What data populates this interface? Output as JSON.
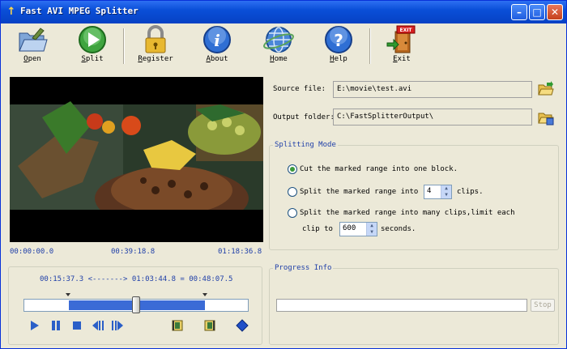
{
  "window": {
    "title": "Fast AVI MPEG Splitter"
  },
  "toolbar": {
    "open": "Open",
    "split": "Split",
    "register": "Register",
    "about": "About",
    "home": "Home",
    "help": "Help",
    "exit": "Exit",
    "exit_sign": "EXIT"
  },
  "player": {
    "time_start": "00:00:00.0",
    "time_current": "00:39:18.8",
    "time_end": "01:18:36.8",
    "range_start": "00:15:37.3",
    "range_arrow": "<------->",
    "range_end": "01:03:44.8",
    "range_equals": "=",
    "range_length": "00:48:07.5",
    "position_fraction": 0.5,
    "selection_start_fraction": 0.2,
    "selection_end_fraction": 0.81
  },
  "files": {
    "source_label": "Source file:",
    "source_value": "E:\\movie\\test.avi",
    "output_label": "Output folder:",
    "output_value": "C:\\FastSplitterOutput\\"
  },
  "splitting": {
    "legend": "Splitting Mode",
    "option1": "Cut the marked range into one block.",
    "option2_pre": "Split the marked range into",
    "option2_value": "4",
    "option2_post": "clips.",
    "option3_line1": "Split the marked range into many clips,limit each",
    "option3_pre": "clip to",
    "option3_value": "600",
    "option3_post": "seconds.",
    "selected": 1
  },
  "progress": {
    "legend": "Progress Info",
    "stop_label": "Stop",
    "percent": 0
  },
  "colors": {
    "title_bar": "#0a4fd8",
    "accent_text": "#1f3fa8",
    "selection": "#3b6bd6"
  }
}
